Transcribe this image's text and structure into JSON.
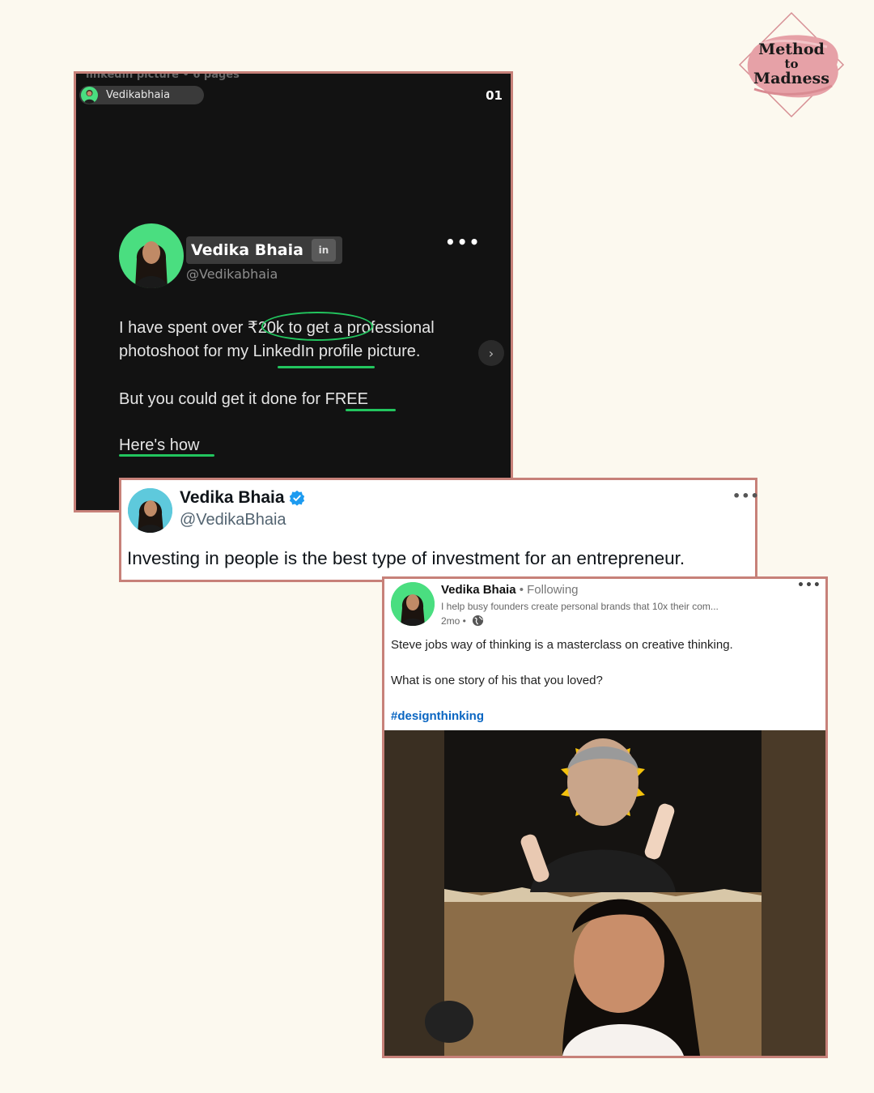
{
  "logo": {
    "line1": "Method",
    "line2": "to",
    "line3": "Madness",
    "color": "#e6a1a7"
  },
  "carousel": {
    "top_cut_text": "linkedin picture • 6 pages",
    "pill_name": "Vedikabhaia",
    "page_number": "01",
    "name": "Vedika Bhaia",
    "linkedin_badge": "in",
    "handle": "@Vedikabhaia",
    "line1_a": "I have spent over ",
    "line1_highlight": "₹20k to get",
    "line1_b": " a professional",
    "line2": "photoshoot for my LinkedIn profile picture.",
    "line3": "But you could get it done for FREE",
    "line4": "Here's how",
    "accent": "#22c55e"
  },
  "tweet": {
    "name": "Vedika Bhaia",
    "handle": "@VedikaBhaia",
    "text": "Investing in people is the best type of investment for an entrepreneur.",
    "verified_color": "#1d9bf0"
  },
  "linkedin_post": {
    "name": "Vedika Bhaia",
    "follow": " • Following",
    "tagline": "I help busy founders create personal brands that 10x their com...",
    "time": "2mo •",
    "body1": "Steve jobs way of thinking is a masterclass on creative thinking.",
    "body2": "What is one story of his that you loved?",
    "hashtag": "#designthinking",
    "hashtag_color": "#0a66c2"
  },
  "frame_color": "#c78179"
}
